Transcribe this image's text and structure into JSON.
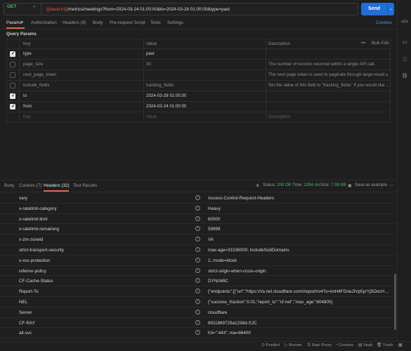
{
  "request": {
    "method": "GET",
    "url_var": "{{baseUrl}}",
    "url_rest": "/metrics/meetings?from=2024-03-24 01:00:00&to=2024-03-28 01:00:00&type=past",
    "send_label": "Send"
  },
  "tabs": {
    "params": "Params",
    "authorization": "Authorization",
    "headers": "Headers (9)",
    "body": "Body",
    "pre_request": "Pre-request Script",
    "tests": "Tests",
    "settings": "Settings",
    "cookies": "Cookies"
  },
  "query_params_label": "Query Params",
  "params_table": {
    "headers": {
      "key": "Key",
      "value": "Value",
      "description": "Description",
      "bulk_edit": "Bulk Edit"
    },
    "rows": [
      {
        "checked": true,
        "key": "type",
        "value": "past",
        "description": ""
      },
      {
        "checked": false,
        "key": "page_size",
        "value": "30",
        "description": "The number of records returned within a single API call."
      },
      {
        "checked": false,
        "key": "next_page_token",
        "value": "",
        "description": "The next page token is used to paginate through large result s..."
      },
      {
        "checked": false,
        "key": "include_fields",
        "value": "tracking_fields",
        "description": "Set the value of this field to \"tracking_fields\" if you would like ..."
      },
      {
        "checked": true,
        "key": "to",
        "value": "2024-03-28 01:00:00",
        "description": ""
      },
      {
        "checked": true,
        "key": "from",
        "value": "2024-03-24 01:00:00",
        "description": ""
      }
    ],
    "placeholder": {
      "key": "Key",
      "value": "Value",
      "description": "Description"
    }
  },
  "response": {
    "tabs": {
      "body": "Body",
      "cookies": "Cookies (7)",
      "headers": "Headers (32)",
      "test_results": "Test Results"
    },
    "status_label": "Status:",
    "status_value": "200 OK",
    "time_label": "Time:",
    "time_value": "1294 ms",
    "size_label": "Size:",
    "size_value": "7.08 KB",
    "save_label": "Save as example",
    "headers": [
      {
        "key": "vary",
        "value": "Access-Control-Request-Headers"
      },
      {
        "key": "x-ratelimit-category",
        "value": "Heavy"
      },
      {
        "key": "x-ratelimit-limit",
        "value": "60000"
      },
      {
        "key": "x-ratelimit-remaining",
        "value": "59999"
      },
      {
        "key": "x-zm-zoneid",
        "value": "VA"
      },
      {
        "key": "strict-transport-security",
        "value": "max-age=31536000; includeSubDomains"
      },
      {
        "key": "x-xss-protection",
        "value": "1; mode=block"
      },
      {
        "key": "referrer-policy",
        "value": "strict-origin-when-cross-origin"
      },
      {
        "key": "CF-Cache-Status",
        "value": "DYNAMIC"
      },
      {
        "key": "Report-To",
        "value": "{\"endpoints\":[{\"url\":\"https:\\/\\/a.nel.cloudflare.com\\/report\\/v4?s=imH4FGneJIVp5yrYj5OocH7nTsDKs2...\"}"
      },
      {
        "key": "NEL",
        "value": "{\"success_fraction\":0.01,\"report_to\":\"cf-nel\",\"max_age\":604800}"
      },
      {
        "key": "Server",
        "value": "cloudflare"
      },
      {
        "key": "CF-RAY",
        "value": "8911869729a1238d-SJC"
      },
      {
        "key": "alt-svc",
        "value": "h3=\":443\"; ma=86400"
      }
    ]
  },
  "status_bar": {
    "postbot": "Postbot",
    "runner": "Runner",
    "start_proxy": "Start Proxy",
    "cookies": "Cookies",
    "vault": "Vault",
    "trash": "Trash"
  }
}
